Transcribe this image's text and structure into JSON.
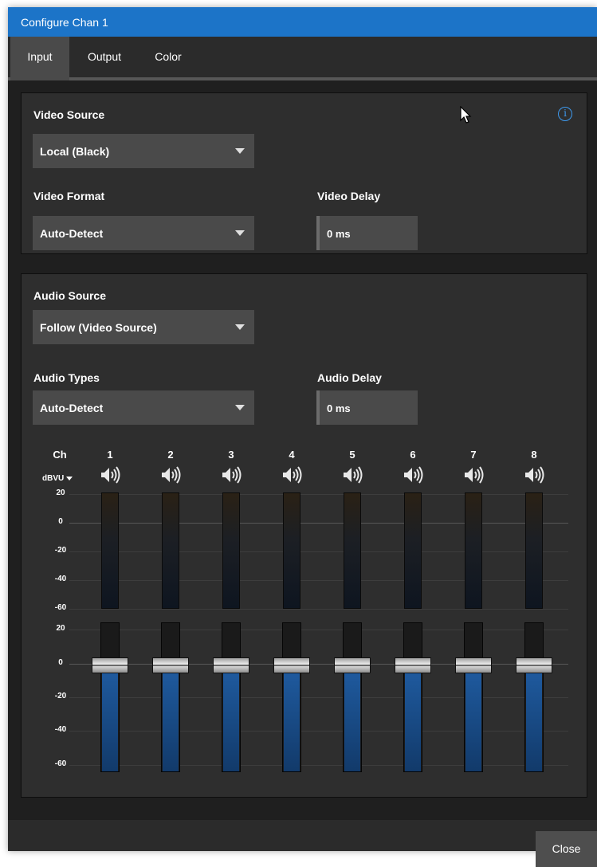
{
  "window": {
    "title": "Configure Chan 1"
  },
  "tabs": [
    {
      "label": "Input",
      "active": true
    },
    {
      "label": "Output",
      "active": false
    },
    {
      "label": "Color",
      "active": false
    }
  ],
  "video": {
    "source_label": "Video Source",
    "source_value": "Local (Black)",
    "format_label": "Video Format",
    "format_value": "Auto-Detect",
    "delay_label": "Video Delay",
    "delay_value": "0 ms",
    "info_icon": "i"
  },
  "audio": {
    "source_label": "Audio Source",
    "source_value": "Follow (Video Source)",
    "types_label": "Audio Types",
    "types_value": "Auto-Detect",
    "delay_label": "Audio Delay",
    "delay_value": "0 ms"
  },
  "mixer": {
    "ch_label": "Ch",
    "unit_label": "dBVU",
    "channels": [
      "1",
      "2",
      "3",
      "4",
      "5",
      "6",
      "7",
      "8"
    ],
    "meter_scale": [
      "20",
      "0",
      "-20",
      "-40",
      "-60"
    ],
    "fader_scale": [
      "20",
      "0",
      "-20",
      "-40",
      "-60"
    ],
    "fader_level_db": [
      0,
      0,
      0,
      0,
      0,
      0,
      0,
      0
    ],
    "speaker_icon": "speaker-volume-icon"
  },
  "footer": {
    "close_label": "Close"
  },
  "colors": {
    "titlebar": "#1c74c8",
    "panel": "#2e2e2e",
    "fader_fill": "#1f5ba0",
    "info_accent": "#3e9bf0"
  }
}
